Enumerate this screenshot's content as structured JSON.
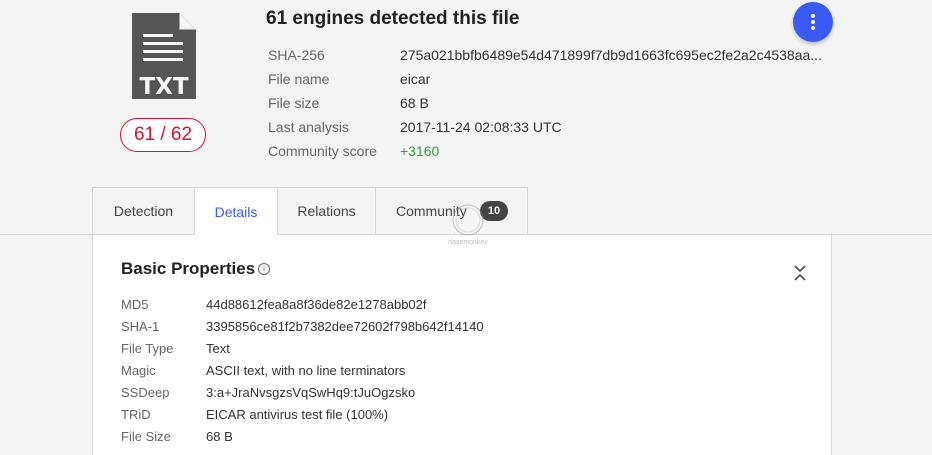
{
  "file": {
    "icon_label": "TXT",
    "detection_ratio": "61 / 62",
    "title": "61 engines detected this file",
    "info": [
      {
        "label": "SHA-256",
        "value": "275a021bbfb6489e54d471899f7db9d1663fc695ec2fe2a2c4538aa..."
      },
      {
        "label": "File name",
        "value": "eicar"
      },
      {
        "label": "File size",
        "value": "68 B"
      },
      {
        "label": "Last analysis",
        "value": "2017-11-24 02:08:33 UTC"
      },
      {
        "label": "Community score",
        "value": "+3160"
      }
    ]
  },
  "tabs": [
    {
      "label": "Detection"
    },
    {
      "label": "Details"
    },
    {
      "label": "Relations"
    },
    {
      "label": "Community",
      "badge": "10"
    }
  ],
  "section": {
    "title": "Basic Properties",
    "info_glyph": "i",
    "properties": [
      {
        "label": "MD5",
        "value": "44d88612fea8a8f36de82e1278abb02f"
      },
      {
        "label": "SHA-1",
        "value": "3395856ce81f2b7382dee72602f798b642f14140"
      },
      {
        "label": "File Type",
        "value": "Text"
      },
      {
        "label": "Magic",
        "value": "ASCII text, with no line terminators"
      },
      {
        "label": "SSDeep",
        "value": "3:a+JraNvsgzsVqSwHq9:tJuOgzsko"
      },
      {
        "label": "TRiD",
        "value": "EICAR antivirus test file (100%)"
      },
      {
        "label": "File Size",
        "value": "68 B"
      }
    ]
  },
  "watermark": {
    "text": "dazemonkey"
  },
  "colors": {
    "accent": "#3a5af6",
    "danger": "#e00f2f",
    "positive": "#29a73b"
  }
}
